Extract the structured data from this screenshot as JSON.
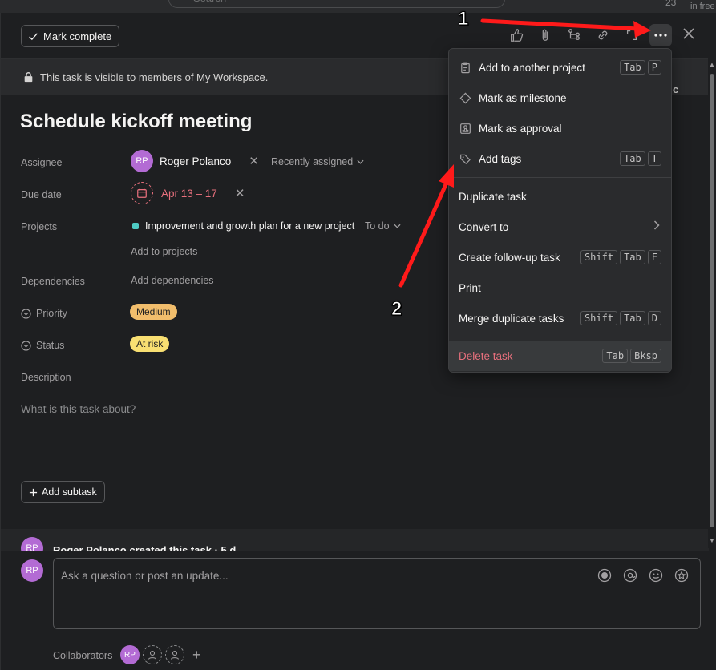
{
  "topbar": {
    "search_placeholder": "Search",
    "count": "23",
    "free_label": "in free"
  },
  "header": {
    "mark_complete": "Mark complete",
    "icons": [
      "thumbs-up-icon",
      "paperclip-icon",
      "subtask-icon",
      "link-icon",
      "expand-icon",
      "more-icon",
      "close-icon"
    ]
  },
  "privacy": {
    "text": "This task is visible to members of My Workspace.",
    "partial_right": "c"
  },
  "task": {
    "title": "Schedule kickoff meeting",
    "fields": {
      "assignee_label": "Assignee",
      "assignee_initials": "RP",
      "assignee_name": "Roger Polanco",
      "recently_assigned": "Recently assigned",
      "due_label": "Due date",
      "due_value": "Apr 13 – 17",
      "projects_label": "Projects",
      "project_name": "Improvement and growth plan for a new project",
      "project_section": "To do",
      "add_to_projects": "Add to projects",
      "dependencies_label": "Dependencies",
      "add_dependencies": "Add dependencies",
      "priority_label": "Priority",
      "priority_value": "Medium",
      "status_label": "Status",
      "status_value": "At risk",
      "description_label": "Description",
      "description_placeholder": "What is this task about?"
    },
    "add_subtask": "Add subtask"
  },
  "activity": {
    "initials": "RP",
    "text": "Roger Polanco created this task · 5 d"
  },
  "composer": {
    "initials": "RP",
    "placeholder": "Ask a question or post an update...",
    "collaborators_label": "Collaborators",
    "collab_initials": "RP"
  },
  "menu": {
    "items": [
      {
        "label": "Add to another project",
        "keys": [
          "Tab",
          "P"
        ],
        "icon": "clipboard-icon"
      },
      {
        "label": "Mark as milestone",
        "keys": [],
        "icon": "diamond-icon"
      },
      {
        "label": "Mark as approval",
        "keys": [],
        "icon": "approval-icon"
      },
      {
        "label": "Add tags",
        "keys": [
          "Tab",
          "T"
        ],
        "icon": "tag-icon"
      },
      {
        "label": "Duplicate task",
        "keys": []
      },
      {
        "label": "Convert to",
        "keys": []
      },
      {
        "label": "Create follow-up task",
        "keys": [
          "Shift",
          "Tab",
          "F"
        ]
      },
      {
        "label": "Print",
        "keys": []
      },
      {
        "label": "Merge duplicate tasks",
        "keys": [
          "Shift",
          "Tab",
          "D"
        ]
      },
      {
        "label": "Delete task",
        "keys": [
          "Tab",
          "Bksp"
        ]
      }
    ]
  },
  "annotations": {
    "one": "1",
    "two": "2"
  },
  "colors": {
    "accent_red": "#e8707d",
    "medium": "#f1bd6c",
    "at_risk": "#f8df72",
    "avatar": "#b36bd4",
    "arrow": "#ff1a1a"
  }
}
